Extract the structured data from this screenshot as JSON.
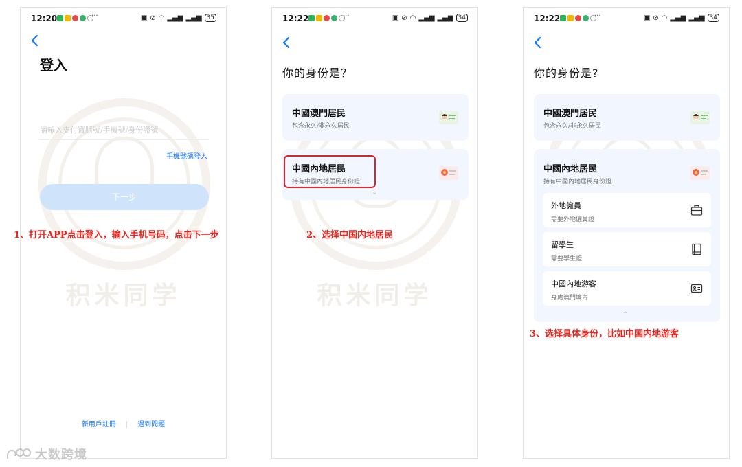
{
  "steps": [
    {
      "status_time": "12:20",
      "battery": "35",
      "title": "登入",
      "account_placeholder": "請輸入支付寶賬號/手機號/身份證號",
      "phone_login_link": "手機號碼登入",
      "next_button": "下一步",
      "register_link": "新用戶註冊",
      "help_link": "遇到問題",
      "caption": "1、打开APP点击登入，输入手机号码，点击下一步"
    },
    {
      "status_time": "12:22",
      "battery": "34",
      "question": "你的身份是？",
      "cards": [
        {
          "title": "中國澳門居民",
          "subtitle": "包含永久/非永久居民"
        },
        {
          "title": "中國內地居民",
          "subtitle": "持有中國內地居民身份證"
        }
      ],
      "caption": "2、选择中国内地居民"
    },
    {
      "status_time": "12:22",
      "battery": "34",
      "question": "你的身份是?",
      "cards": [
        {
          "title": "中國澳門居民",
          "subtitle": "包含永久/非永久居民"
        },
        {
          "title": "中國內地居民",
          "subtitle": "持有中國內地居民身份證"
        }
      ],
      "sub_options": [
        {
          "title": "外地僱員",
          "subtitle": "需要外地僱員證",
          "icon": "briefcase-icon"
        },
        {
          "title": "留學生",
          "subtitle": "需要學生證",
          "icon": "book-icon"
        },
        {
          "title": "中國內地游客",
          "subtitle": "身處澳門境內",
          "icon": "id-card-icon"
        }
      ],
      "caption": "3、选择具体身份，比如中国内地游客"
    }
  ],
  "watermark_text": "积米同学",
  "corner_logo_text": "大数跨境",
  "colors": {
    "accent": "#1677ff",
    "caption_red": "#e8261f",
    "card_bg": "#f1f6ff"
  }
}
